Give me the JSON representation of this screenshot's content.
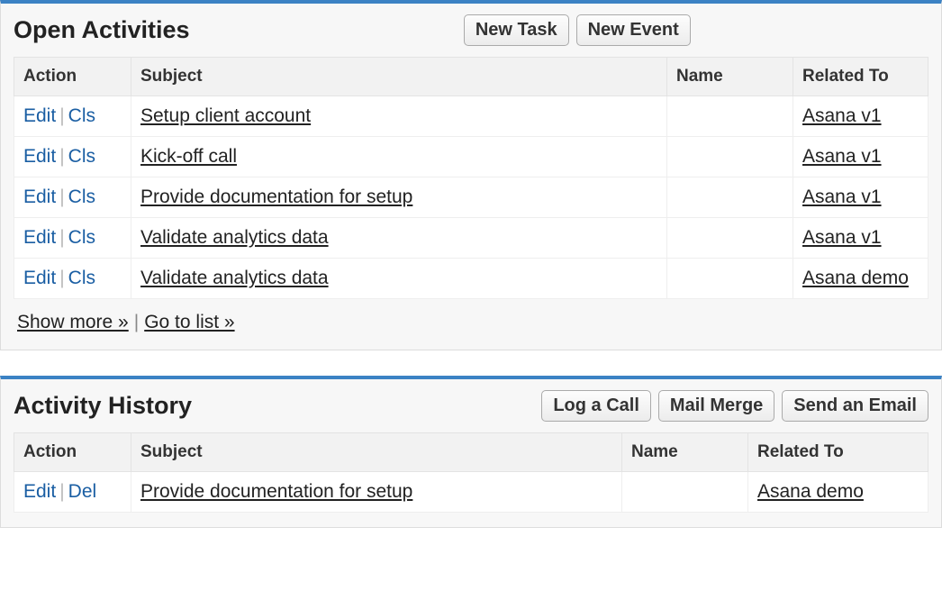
{
  "open_activities": {
    "title": "Open Activities",
    "buttons": {
      "new_task": "New Task",
      "new_event": "New Event"
    },
    "headers": {
      "action": "Action",
      "subject": "Subject",
      "name": "Name",
      "related": "Related To"
    },
    "action_labels": {
      "edit": "Edit",
      "cls": "Cls"
    },
    "rows": [
      {
        "subject": "Setup client account",
        "name": "",
        "related": "Asana v1"
      },
      {
        "subject": "Kick-off call",
        "name": "",
        "related": "Asana v1"
      },
      {
        "subject": "Provide documentation for setup",
        "name": "",
        "related": "Asana v1"
      },
      {
        "subject": "Validate analytics data",
        "name": "",
        "related": "Asana v1"
      },
      {
        "subject": "Validate analytics data",
        "name": "",
        "related": "Asana demo"
      }
    ],
    "footer": {
      "show_more": "Show more »",
      "go_to_list": "Go to list »"
    }
  },
  "activity_history": {
    "title": "Activity History",
    "buttons": {
      "log_call": "Log a Call",
      "mail_merge": "Mail Merge",
      "send_email": "Send an Email"
    },
    "headers": {
      "action": "Action",
      "subject": "Subject",
      "name": "Name",
      "related": "Related To"
    },
    "action_labels": {
      "edit": "Edit",
      "del": "Del"
    },
    "rows": [
      {
        "subject": "Provide documentation for setup",
        "name": "",
        "related": "Asana demo"
      }
    ]
  }
}
